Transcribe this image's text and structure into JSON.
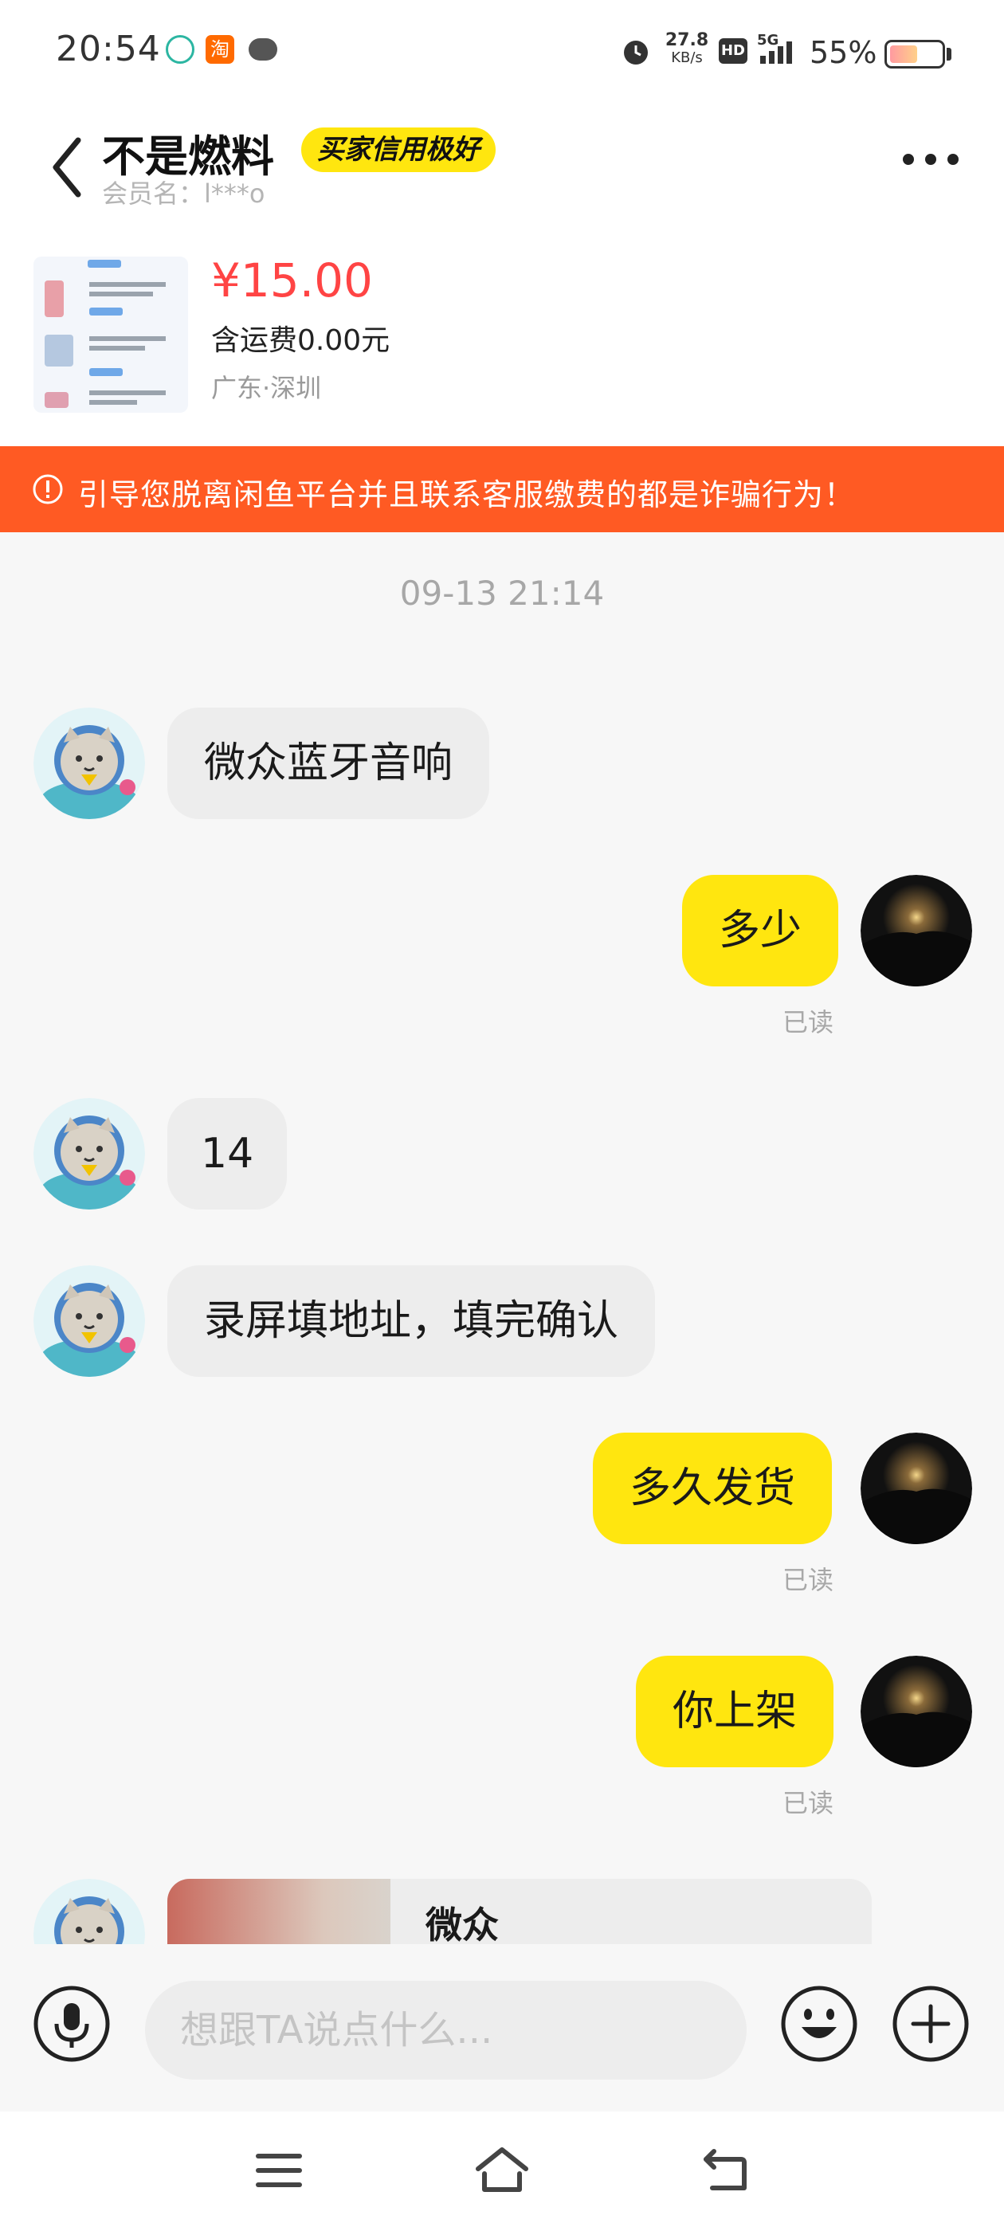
{
  "status_bar": {
    "time": "20:54",
    "net_speed_value": "27.8",
    "net_speed_unit": "KB/s",
    "hd_label": "HD",
    "network_label": "5G",
    "battery_percent": "55%",
    "battery_level": 0.55,
    "icons": [
      "wechat-icon",
      "taobao-icon",
      "message-icon",
      "alarm-icon",
      "hd-icon",
      "signal-icon",
      "battery-icon"
    ],
    "taobao_glyph": "淘"
  },
  "header": {
    "title": "不是燃料",
    "credit_badge": "买家信用极好",
    "member_name": "会员名：l***o"
  },
  "product": {
    "price": "¥15.00",
    "shipping": "含运费0.00元",
    "location": "广东·深圳"
  },
  "warning": {
    "text": "引导您脱离闲鱼平台并且联系客服缴费的都是诈骗行为！",
    "color": "#ff5a23"
  },
  "chat": {
    "timestamp": "09-13 21:14",
    "read_label": "已读",
    "messages": [
      {
        "from": "seller",
        "text": "微众蓝牙音响"
      },
      {
        "from": "me",
        "text": "多少",
        "status": "已读"
      },
      {
        "from": "seller",
        "text": "14"
      },
      {
        "from": "seller",
        "text": "录屏填地址，填完确认"
      },
      {
        "from": "me",
        "text": "多久发货",
        "status": "已读"
      },
      {
        "from": "me",
        "text": "你上架",
        "status": "已读"
      },
      {
        "from": "seller",
        "type": "item-card",
        "text": "微众"
      }
    ]
  },
  "input": {
    "placeholder": "想跟TA说点什么..."
  },
  "colors": {
    "accent_yellow": "#ffe60f",
    "price_red": "#ff4444",
    "warning_orange": "#ff5a23"
  }
}
